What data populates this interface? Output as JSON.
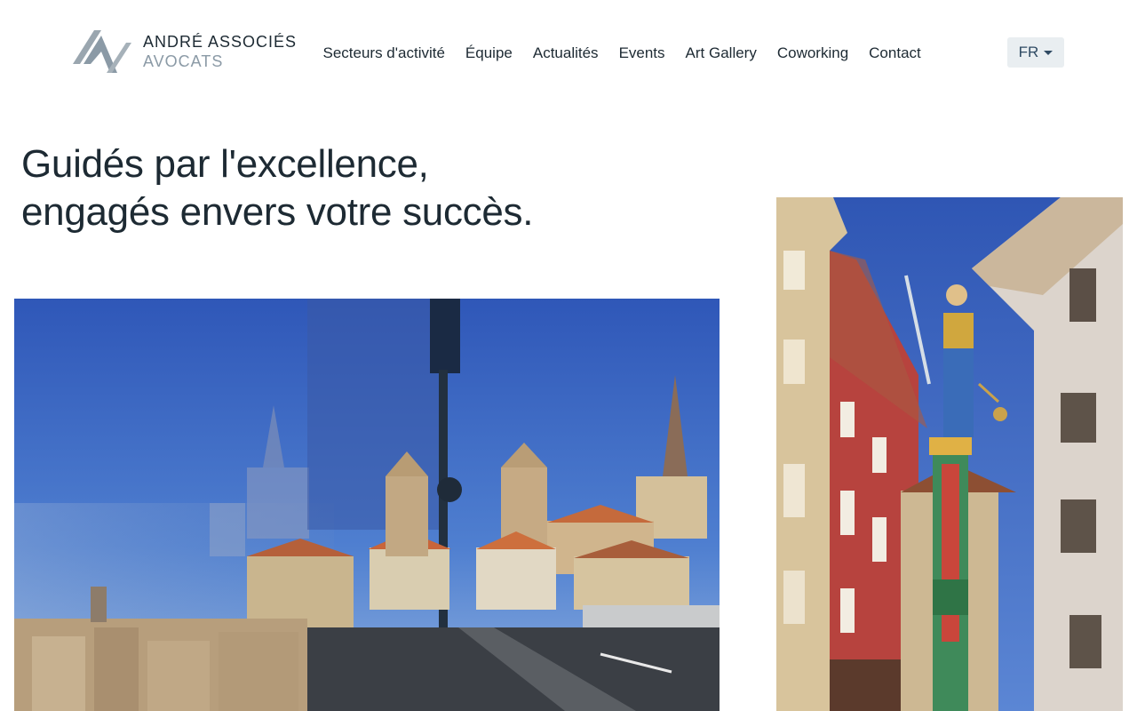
{
  "brand": {
    "name": "ANDRÉ ASSOCIÉS",
    "subtitle": "AVOCATS",
    "logo_icon": "andre-associes-logo-mark",
    "colors": {
      "primary": "#1d2a33",
      "muted": "#8b9aa6",
      "accent": "#2f4a63"
    }
  },
  "nav": {
    "items": [
      {
        "label": "Secteurs d'activité"
      },
      {
        "label": "Équipe"
      },
      {
        "label": "Actualités"
      },
      {
        "label": "Events"
      },
      {
        "label": "Art Gallery"
      },
      {
        "label": "Coworking"
      },
      {
        "label": "Contact"
      }
    ]
  },
  "language": {
    "selected": "FR",
    "icon": "caret-down-icon"
  },
  "hero": {
    "title_line1": "Guidés par l'excellence,",
    "title_line2": "engagés envers votre succès."
  },
  "images": {
    "left": "photo of Lausanne cathedral from bridge with glass reflection",
    "right": "photo of Justice fountain statue among old town buildings"
  }
}
